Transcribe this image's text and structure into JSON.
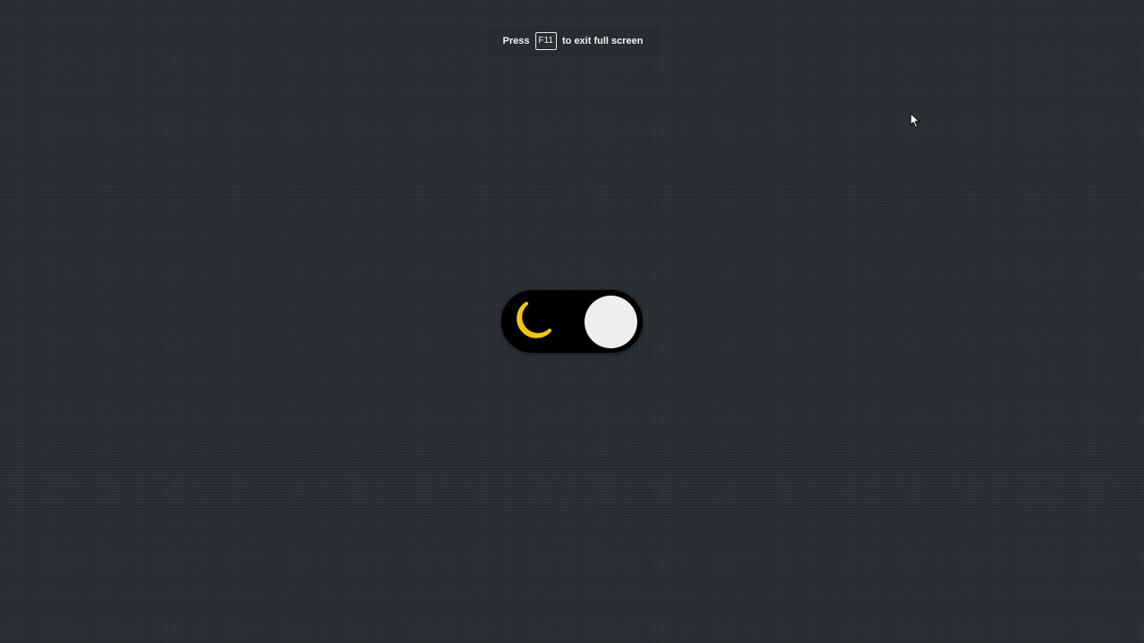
{
  "fullscreen_hint": {
    "prefix": "Press",
    "key": "F11",
    "suffix": "to exit full screen"
  },
  "theme_toggle": {
    "state": "dark",
    "checked": true,
    "icon": "moon-icon",
    "colors": {
      "track": "#000000",
      "knob": "#eeeeee",
      "icon": "#f2c618"
    }
  },
  "page": {
    "background": "#2b2f36"
  },
  "cursor": {
    "icon": "mouse-pointer-icon"
  }
}
